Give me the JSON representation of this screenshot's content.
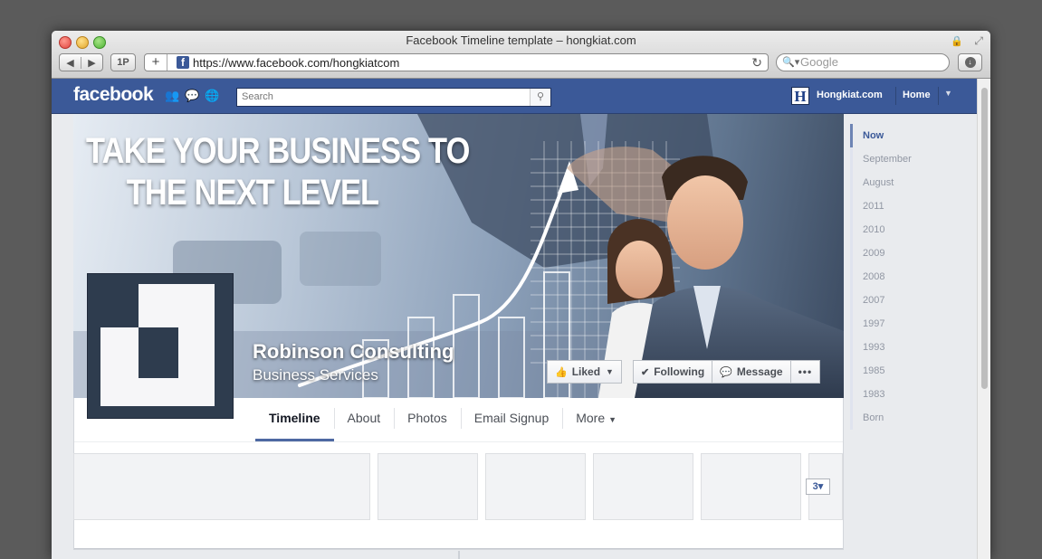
{
  "browser": {
    "window_title": "Facebook Timeline template – hongkiat.com",
    "nav_back": "◀",
    "nav_forward": "▶",
    "onepassword_label": "1P",
    "add_tab": "+",
    "favicon_letter": "f",
    "url": "https://www.facebook.com/hongkiatcom",
    "search_placeholder": "Google"
  },
  "facebook": {
    "logo": "facebook",
    "search_placeholder": "Search",
    "brand_letter": "H",
    "user_name": "Hongkiat.com",
    "home_label": "Home"
  },
  "cover": {
    "headline_line1": "TAKE YOUR BUSINESS TO",
    "headline_line2": "THE NEXT LEVEL",
    "page_name": "Robinson Consulting",
    "page_category": "Business Services"
  },
  "actions": {
    "liked": "Liked",
    "following": "Following",
    "message": "Message",
    "more": "•••"
  },
  "tabs": {
    "timeline": "Timeline",
    "about": "About",
    "photos": "Photos",
    "email_signup": "Email Signup",
    "more": "More"
  },
  "apps": {
    "count_label": "3"
  },
  "timeline_nav": [
    "Now",
    "September",
    "August",
    "2011",
    "2010",
    "2009",
    "2008",
    "2007",
    "1997",
    "1993",
    "1985",
    "1983",
    "Born"
  ],
  "colors": {
    "facebook_blue": "#3b5998",
    "active_tab_underline": "#4e69a2",
    "timeline_active": "#6d84b4"
  }
}
